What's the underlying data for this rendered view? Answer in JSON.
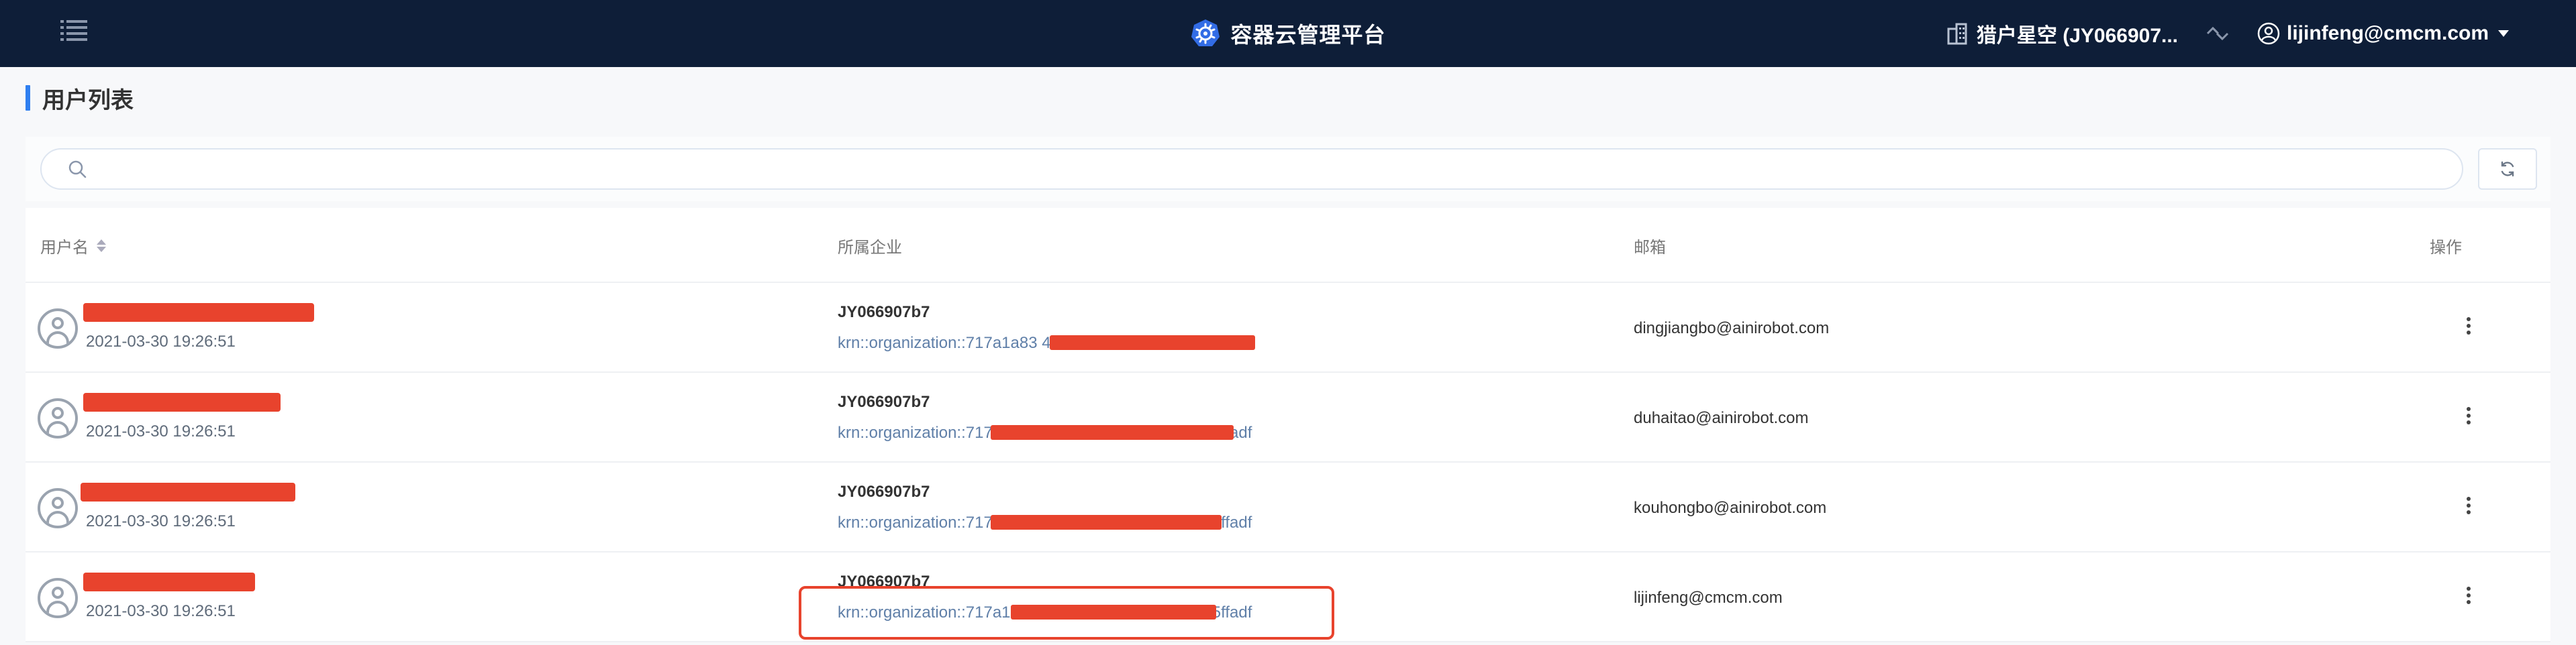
{
  "header": {
    "title": "容器云管理平台",
    "org_label": "猎户星空 (JY066907...",
    "user_label": "lijinfeng@cmcm.com",
    "bg_color": "#0e1e38"
  },
  "page": {
    "title": "用户列表",
    "accent": "#2f7ff0"
  },
  "search": {
    "placeholder": "",
    "value": ""
  },
  "table": {
    "columns": {
      "username": "用户名",
      "org": "所属企业",
      "email": "邮箱",
      "actions": "操作"
    },
    "rows": [
      {
        "created": "2021-03-30 19:26:51",
        "org_name": "JY066907b7",
        "krn": "krn::organization::717a1a83 4d55 4f33 9a57 9817785ffadf",
        "email": "dingjiangbo@ainirobot.com"
      },
      {
        "created": "2021-03-30 19:26:51",
        "org_name": "JY066907b7",
        "krn": "krn::organization::717a1a83 4d55 4f33 9a57 9817785ffadf",
        "email": "duhaitao@ainirobot.com"
      },
      {
        "created": "2021-03-30 19:26:51",
        "org_name": "JY066907b7",
        "krn": "krn::organization::717a1a83 4d55 4f33 9a57 9817785ffadf",
        "email": "kouhongbo@ainirobot.com"
      },
      {
        "created": "2021-03-30 19:26:51",
        "org_name": "JY066907b7",
        "krn": "krn::organization::717a1a83 4d55 4f33 9a57 9817785ffadf",
        "email": "lijinfeng@cmcm.com"
      }
    ]
  },
  "redaction_color": "#e8432d"
}
